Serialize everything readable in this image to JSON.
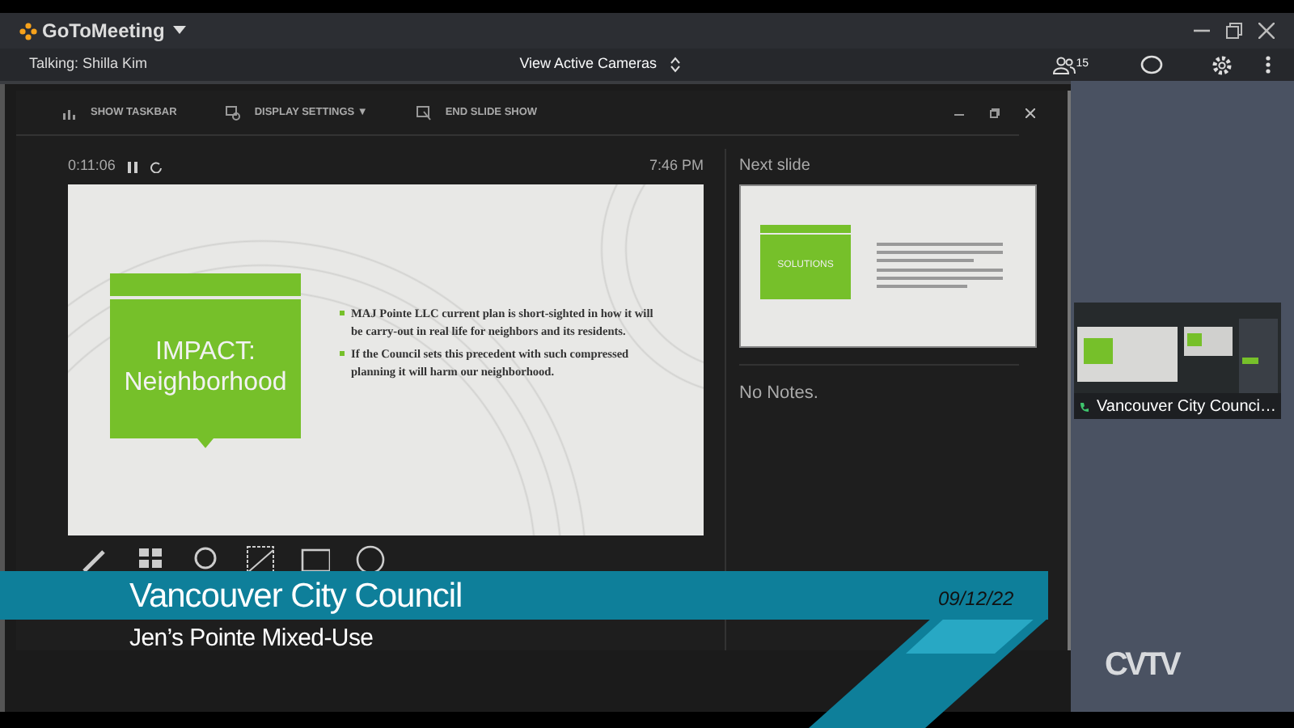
{
  "app": {
    "title": "GoToMeeting"
  },
  "toolbar": {
    "talking": "Talking: Shilla Kim",
    "view": "View Active Cameras",
    "participants": "15"
  },
  "presenter": {
    "commands": [
      {
        "kind": "taskbar",
        "label": "SHOW TASKBAR"
      },
      {
        "kind": "display",
        "label": "DISPLAY SETTINGS ▼"
      },
      {
        "kind": "end",
        "label": "END SLIDE SHOW"
      }
    ],
    "timer": "0:11:06",
    "clock": "7:46 PM",
    "slide": {
      "title": "IMPACT: Neighborhood",
      "bullets": [
        "MAJ Pointe LLC current plan is short-sighted in how it will be carry-out in real life for neighbors and its residents.",
        "If the Council sets this precedent with such compressed planning it will harm our neighborhood."
      ]
    },
    "next_slide": {
      "label": "Next slide",
      "title": "SOLUTIONS"
    },
    "notes": "No Notes."
  },
  "thumbnail": {
    "caption": "Vancouver City Counci…"
  },
  "lower_third": {
    "title": "Vancouver City Council",
    "subtitle": "Jen’s Pointe Mixed-Use",
    "date": "09/12/22"
  },
  "logo": "CVTV"
}
